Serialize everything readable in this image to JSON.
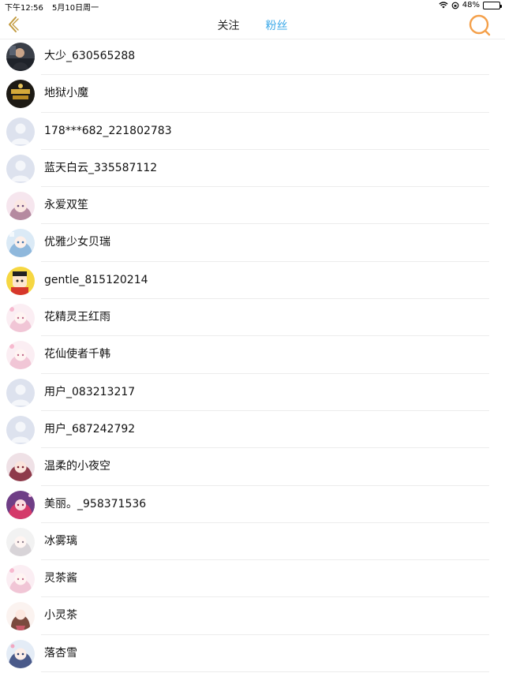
{
  "status": {
    "time": "下午12:56",
    "date": "5月10日周一",
    "battery": "48%",
    "battery_level": 0.48
  },
  "nav": {
    "tab_follow": "关注",
    "tab_fans": "粉丝",
    "active_tab": "fans",
    "accent_color": "#3aa8e8",
    "search_color": "#f4a04a",
    "back_color": "#c29a3e"
  },
  "users": [
    {
      "name": "大少_630565288",
      "avatar": "photo-dark"
    },
    {
      "name": "地狱小魔",
      "avatar": "gold-logo"
    },
    {
      "name": "178***682_221802783",
      "avatar": "default"
    },
    {
      "name": "蓝天白云_335587112",
      "avatar": "default"
    },
    {
      "name": "永爱双笙",
      "avatar": "anime-girl-pink"
    },
    {
      "name": "优雅少女贝瑞",
      "avatar": "anime-girl-blue"
    },
    {
      "name": "gentle_815120214",
      "avatar": "cartoon-yellow"
    },
    {
      "name": "花精灵王红雨",
      "avatar": "anime-girl-pink-light"
    },
    {
      "name": "花仙使者千韩",
      "avatar": "anime-girl-pink-light"
    },
    {
      "name": "用户_083213217",
      "avatar": "default"
    },
    {
      "name": "用户_687242792",
      "avatar": "default"
    },
    {
      "name": "温柔的小夜空",
      "avatar": "anime-girl-red"
    },
    {
      "name": "美丽。_958371536",
      "avatar": "anime-girl-magenta"
    },
    {
      "name": "冰雾璃",
      "avatar": "anime-girl-gray"
    },
    {
      "name": "灵茶酱",
      "avatar": "anime-girl-pink-light"
    },
    {
      "name": "小灵茶",
      "avatar": "anime-girl-brown"
    },
    {
      "name": "落杏雪",
      "avatar": "anime-girl-blue-dark"
    }
  ]
}
